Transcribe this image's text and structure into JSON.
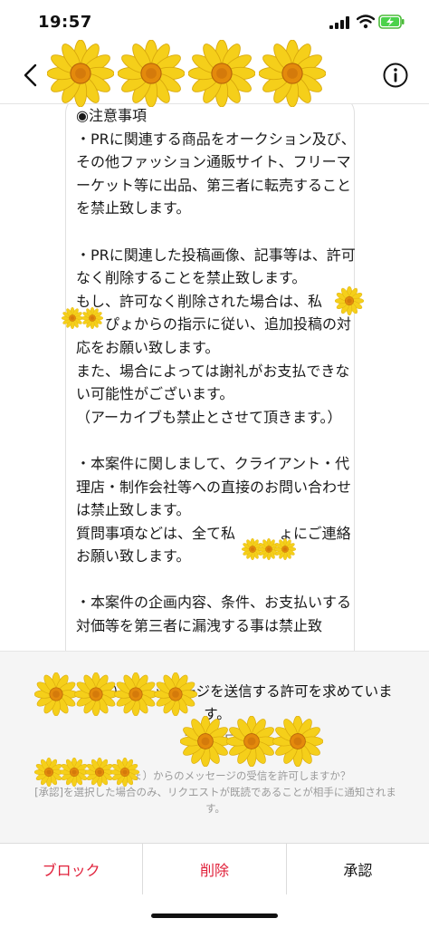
{
  "status_bar": {
    "time": "19:57"
  },
  "header": {
    "title": "",
    "subtitle": "",
    "icons": {
      "back": "chevron-left-icon",
      "info": "info-icon"
    }
  },
  "message": {
    "text": "◉注意事項\n・PRに関連する商品をオークション及び、その他ファッション通販サイト、フリーマーケット等に出品、第三者に転売することを禁止致します。\n\n・PRに関連した投稿画像、記事等は、許可なく削除することを禁止致します。\nもし、許可なく削除された場合は、私\n　　ぴょからの指示に従い、追加投稿の対応をお願い致します。\nまた、場合によっては謝礼がお支払できない可能性がございます。\n（アーカイブも禁止とさせて頂きます。）\n\n・本案件に関しまして、クライアント・代理店・制作会社等への直接のお問い合わせは禁止致します。\n質問事項などは、全て私　　　ょにご連絡お願い致します。\n\n・本案件の企画内容、条件、お支払いする対価等を第三者に漏洩する事は禁止致"
  },
  "request": {
    "title": "　　　　　）がメッセージを送信する許可を求めています。",
    "followers": "フォロワー　　　　　　",
    "question": "　　　　ぴょ）からのメッセージの受信を許可しますか？\n[承認]を選択した場合のみ、リクエストが既読であることが相手に通知されます。"
  },
  "actions": {
    "block": "ブロック",
    "delete": "削除",
    "accept": "承認"
  },
  "colors": {
    "destructive": "#e0203a",
    "flower_petal": "#f5cf1a",
    "flower_center": "#e48a0c"
  }
}
